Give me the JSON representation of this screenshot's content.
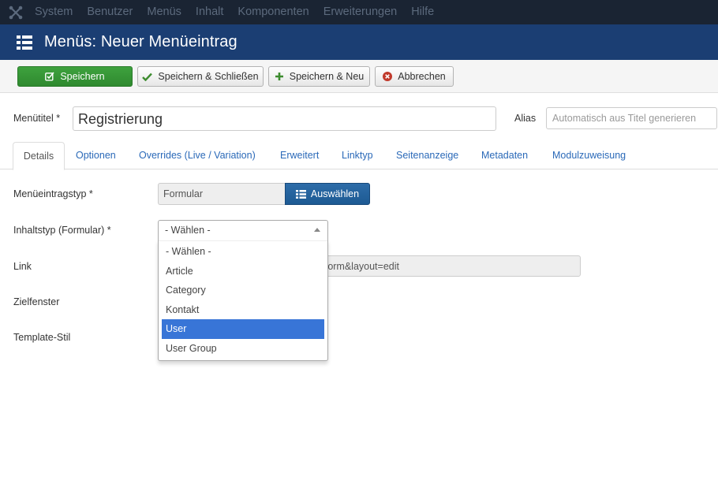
{
  "navbar": {
    "items": [
      "System",
      "Benutzer",
      "Menüs",
      "Inhalt",
      "Komponenten",
      "Erweiterungen",
      "Hilfe"
    ]
  },
  "header": {
    "title": "Menüs: Neuer Menüeintrag"
  },
  "toolbar": {
    "save_label": "Speichern",
    "save_close_label": "Speichern & Schließen",
    "save_new_label": "Speichern & Neu",
    "cancel_label": "Abbrechen"
  },
  "form": {
    "title_label": "Menütitel *",
    "title_value": "Registrierung",
    "alias_label": "Alias",
    "alias_placeholder": "Automatisch aus Titel generieren"
  },
  "tabs": [
    {
      "label": "Details",
      "active": true
    },
    {
      "label": "Optionen"
    },
    {
      "label": "Overrides (Live / Variation)"
    },
    {
      "label": "Erweitert"
    },
    {
      "label": "Linktyp"
    },
    {
      "label": "Seitenanzeige"
    },
    {
      "label": "Metadaten"
    },
    {
      "label": "Modulzuweisung"
    }
  ],
  "details": {
    "menu_item_type_label": "Menüeintragstyp *",
    "menu_item_type_value": "Formular",
    "select_button_label": "Auswählen",
    "content_type_label": "Inhaltstyp (Formular) *",
    "content_type_selected": "- Wählen -",
    "content_type_options": [
      "- Wählen -",
      "Article",
      "Category",
      "Kontakt",
      "User",
      "User Group"
    ],
    "content_type_highlighted": "User",
    "link_label": "Link",
    "link_value": "index.php?option=com_form&view=form&layout=edit",
    "target_window_label": "Zielfenster",
    "template_style_label": "Template-Stil"
  },
  "colors": {
    "navbar_bg": "#1a2433",
    "titlebar_bg": "#1b3e73",
    "save_green": "#3ea23e",
    "select_blue": "#1d5a93",
    "highlight": "#3875d7",
    "link_blue": "#2a69b8"
  },
  "icons": {
    "logo": "joomla-logo",
    "title": "list-icon",
    "save": "edit-check-icon",
    "save_close": "check-icon",
    "save_new": "plus-icon",
    "cancel": "cancel-circle-icon",
    "select": "list-icon",
    "dropdown": "caret-up-icon"
  }
}
